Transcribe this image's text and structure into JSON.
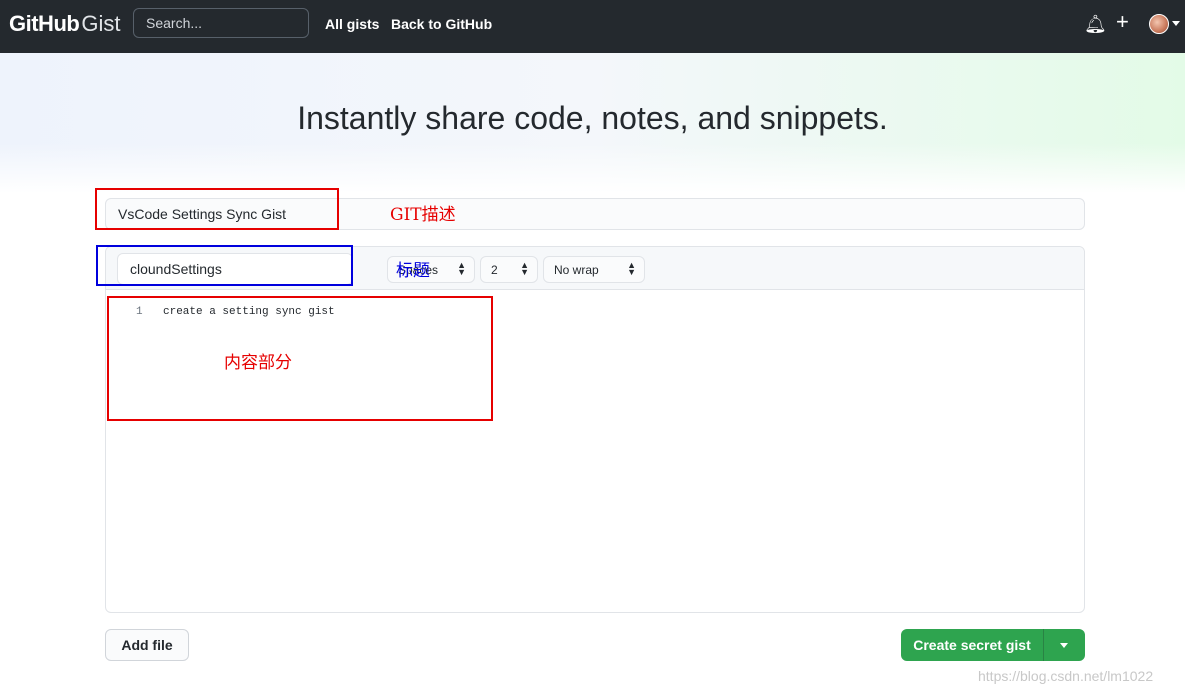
{
  "header": {
    "logo_brand": "GitHub",
    "logo_product": "Gist",
    "search_placeholder": "Search...",
    "nav": {
      "all_gists": "All gists",
      "back_to_github": "Back to GitHub"
    },
    "icons": {
      "notification": "bell-icon",
      "create": "plus-icon"
    }
  },
  "hero": {
    "title": "Instantly share code, notes, and snippets."
  },
  "form": {
    "description_value": "VsCode Settings Sync Gist",
    "filename_value": "cloundSettings",
    "indent_mode": "Spaces",
    "indent_size": "2",
    "wrap_mode": "No wrap",
    "editor": {
      "line_number": "1",
      "line_text": "create a setting sync gist"
    }
  },
  "actions": {
    "add_file": "Add file",
    "create_secret": "Create secret gist"
  },
  "annotations": {
    "description_label": "GIT描述",
    "title_label": "标题",
    "content_label": "内容部分"
  },
  "watermark": "https://blog.csdn.net/lm1022",
  "colors": {
    "header_bg": "#24292e",
    "primary_green": "#2ea44f",
    "annotation_red": "#e60000",
    "annotation_blue": "#0000dd"
  }
}
